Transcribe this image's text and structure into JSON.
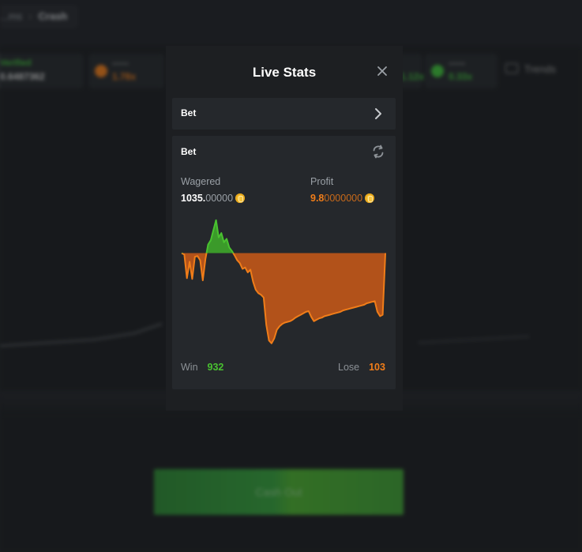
{
  "background": {
    "breadcrumb": {
      "parent": "...ms",
      "current": "Crash"
    },
    "tiles": [
      {
        "line1": "Verified",
        "line2": "0.6487362",
        "color": "#3fc33a"
      },
      {
        "line1": "••••••",
        "line2": "1.78x",
        "color": "#f07d19"
      },
      {
        "line1": "••••••",
        "line2": "1.12x",
        "color": "#3fc33a"
      },
      {
        "line1": "••••••",
        "line2": "0.33x",
        "color": "#3fc33a"
      }
    ],
    "trends_label": "Trends",
    "cashout_label": "Cash Out"
  },
  "modal": {
    "title": "Live Stats",
    "bet_row_label": "Bet",
    "card_title": "Bet",
    "wagered": {
      "label": "Wagered",
      "value_bold": "1035.",
      "value_dim": "00000"
    },
    "profit": {
      "label": "Profit",
      "value_bold": "9.8",
      "value_dim": "0000000"
    },
    "win": {
      "label": "Win",
      "value": "932"
    },
    "lose": {
      "label": "Lose",
      "value": "103"
    }
  },
  "colors": {
    "profit_positive": "#49c130",
    "profit_negative": "#f07d19",
    "negative_fill": "#b2521a",
    "positive_fill": "#3b9a2a",
    "coin": "#f6c33b"
  },
  "chart_data": {
    "type": "area",
    "x": [
      0,
      1,
      2,
      3,
      4,
      5,
      6,
      7,
      8,
      9,
      10,
      11,
      12,
      13,
      14,
      15,
      16,
      17,
      18,
      19,
      20,
      21,
      22,
      23,
      24,
      25,
      26,
      27,
      28,
      29,
      30,
      31,
      32,
      33,
      34,
      35,
      36,
      37,
      38,
      39,
      40,
      41,
      42,
      43,
      44,
      45,
      46,
      47,
      48,
      49,
      50,
      51,
      52,
      53,
      54,
      55,
      56,
      57,
      58,
      59,
      60,
      61,
      62,
      63,
      64,
      65,
      66,
      67,
      68,
      69,
      70,
      71,
      72,
      73,
      74,
      75,
      76,
      77
    ],
    "y": [
      0,
      -0.2,
      -3.5,
      -1.2,
      -3.6,
      -0.5,
      -0.4,
      -1.0,
      -3.8,
      -0.8,
      1.2,
      1.8,
      3.2,
      4.6,
      2.2,
      2.8,
      1.5,
      2.0,
      0.8,
      0.3,
      -0.3,
      -1.0,
      -1.4,
      -2.2,
      -2.0,
      -2.7,
      -2.3,
      -4.0,
      -5.1,
      -5.6,
      -5.8,
      -6.2,
      -10.0,
      -12.2,
      -12.6,
      -11.9,
      -10.7,
      -10.2,
      -9.9,
      -9.7,
      -9.6,
      -9.5,
      -9.3,
      -9.0,
      -8.8,
      -8.6,
      -8.4,
      -8.2,
      -8.1,
      -8.9,
      -9.5,
      -9.3,
      -9.1,
      -9.0,
      -8.8,
      -8.7,
      -8.6,
      -8.5,
      -8.4,
      -8.3,
      -8.2,
      -8.0,
      -7.9,
      -7.8,
      -7.7,
      -7.6,
      -7.5,
      -7.4,
      -7.3,
      -7.2,
      -7.0,
      -6.9,
      -6.8,
      -6.7,
      -8.2,
      -8.8,
      -8.6,
      0
    ],
    "baseline": 0,
    "ylim": [
      -13.5,
      4.8
    ],
    "series": [
      {
        "values": "profit over bets"
      }
    ],
    "legend": "none",
    "grid": false
  }
}
